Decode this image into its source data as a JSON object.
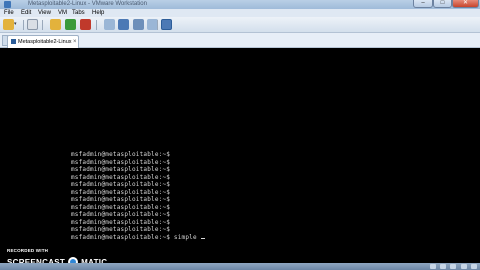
{
  "window": {
    "title": "Metasploitable2-Linux - VMware Workstation",
    "min_glyph": "–",
    "max_glyph": "□",
    "close_glyph": "✕"
  },
  "menu": {
    "items": [
      "File",
      "Edit",
      "View",
      "VM",
      "Tabs",
      "Help"
    ]
  },
  "tabs": {
    "vm_tab_label": "Metasploitable2-Linux",
    "vm_tab_close": "×"
  },
  "terminal": {
    "prompt_lines": [
      "msfadmin@metasploitable:~$",
      "msfadmin@metasploitable:~$",
      "msfadmin@metasploitable:~$",
      "msfadmin@metasploitable:~$",
      "msfadmin@metasploitable:~$",
      "msfadmin@metasploitable:~$",
      "msfadmin@metasploitable:~$",
      "msfadmin@metasploitable:~$",
      "msfadmin@metasploitable:~$",
      "msfadmin@metasploitable:~$",
      "msfadmin@metasploitable:~$",
      "msfadmin@metasploitable:~$ simple "
    ],
    "text_color": "#d8d8d8"
  },
  "watermark": {
    "recorded_with": "RECORDED WITH",
    "brand_left": "SCREENCAST",
    "brand_right": "MATIC"
  },
  "colors": {
    "console_bg": "#000000",
    "chrome_blue": "#b9cfe6",
    "toolbar_icon_yellow": "#e3b23c",
    "toolbar_icon_green": "#3a9a3a",
    "toolbar_icon_red": "#c0392b"
  }
}
